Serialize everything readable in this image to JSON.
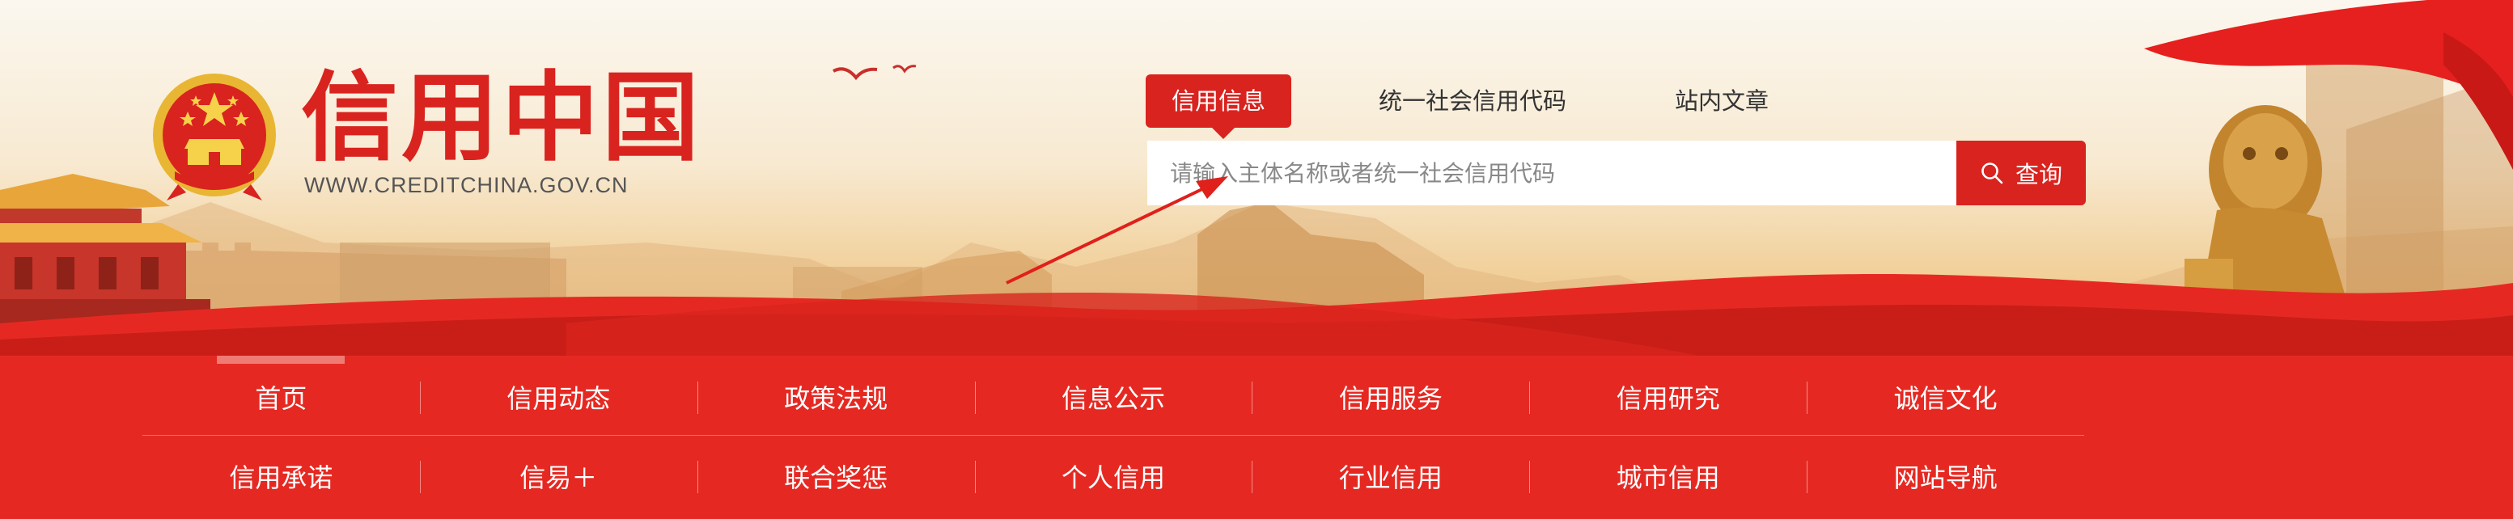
{
  "logo": {
    "title": "信用中国",
    "subtitle": "WWW.CREDITCHINA.GOV.CN"
  },
  "search": {
    "tabs": [
      {
        "label": "信用信息",
        "active": true
      },
      {
        "label": "统一社会信用代码",
        "active": false
      },
      {
        "label": "站内文章",
        "active": false
      }
    ],
    "placeholder": "请输入主体名称或者统一社会信用代码",
    "button_label": "查询",
    "button_icon": "search-icon"
  },
  "nav": {
    "row1": [
      "首页",
      "信用动态",
      "政策法规",
      "信息公示",
      "信用服务",
      "信用研究",
      "诚信文化"
    ],
    "row2": [
      "信用承诺",
      "信易＋",
      "联合奖惩",
      "个人信用",
      "行业信用",
      "城市信用",
      "网站导航"
    ]
  },
  "colors": {
    "brand_red": "#d9231f",
    "nav_red": "#e52922",
    "banner_light": "#fbf7ef",
    "banner_gold": "#e9b877"
  }
}
